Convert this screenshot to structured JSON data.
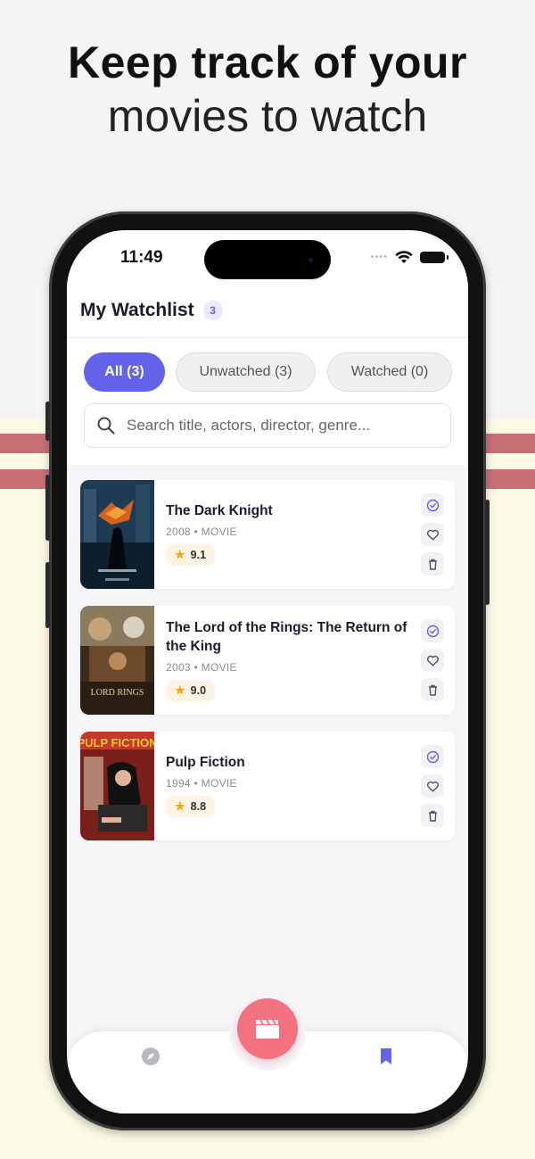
{
  "headline": {
    "line1": "Keep track of your",
    "line2": "movies to watch"
  },
  "status_bar": {
    "time": "11:49"
  },
  "header": {
    "title": "My Watchlist",
    "count": "3"
  },
  "tabs": [
    {
      "label": "All (3)",
      "active": true
    },
    {
      "label": "Unwatched (3)",
      "active": false
    },
    {
      "label": "Watched (0)",
      "active": false
    }
  ],
  "search": {
    "placeholder": "Search title, actors, director, genre..."
  },
  "movies": [
    {
      "title": "The Dark Knight",
      "meta": "2008 • MOVIE",
      "rating": "9.1"
    },
    {
      "title": "The Lord of the Rings: The Return of the King",
      "meta": "2003 • MOVIE",
      "rating": "9.0"
    },
    {
      "title": "Pulp Fiction",
      "meta": "1994 • MOVIE",
      "rating": "8.8"
    }
  ],
  "posters": {
    "pulp_fiction_text": "PULP FICTION",
    "lotr_text": "LORD RINGS"
  },
  "icons": {
    "search": "search-icon",
    "watched": "check-circle-icon",
    "favorite": "heart-icon",
    "delete": "trash-icon",
    "discover": "compass-icon",
    "watchlist": "bookmark-icon",
    "fab": "clapperboard-icon"
  },
  "colors": {
    "accent": "#6461ea",
    "fab": "#f4727f",
    "rating_star": "#f5a623",
    "stripe": "#c86f76"
  }
}
